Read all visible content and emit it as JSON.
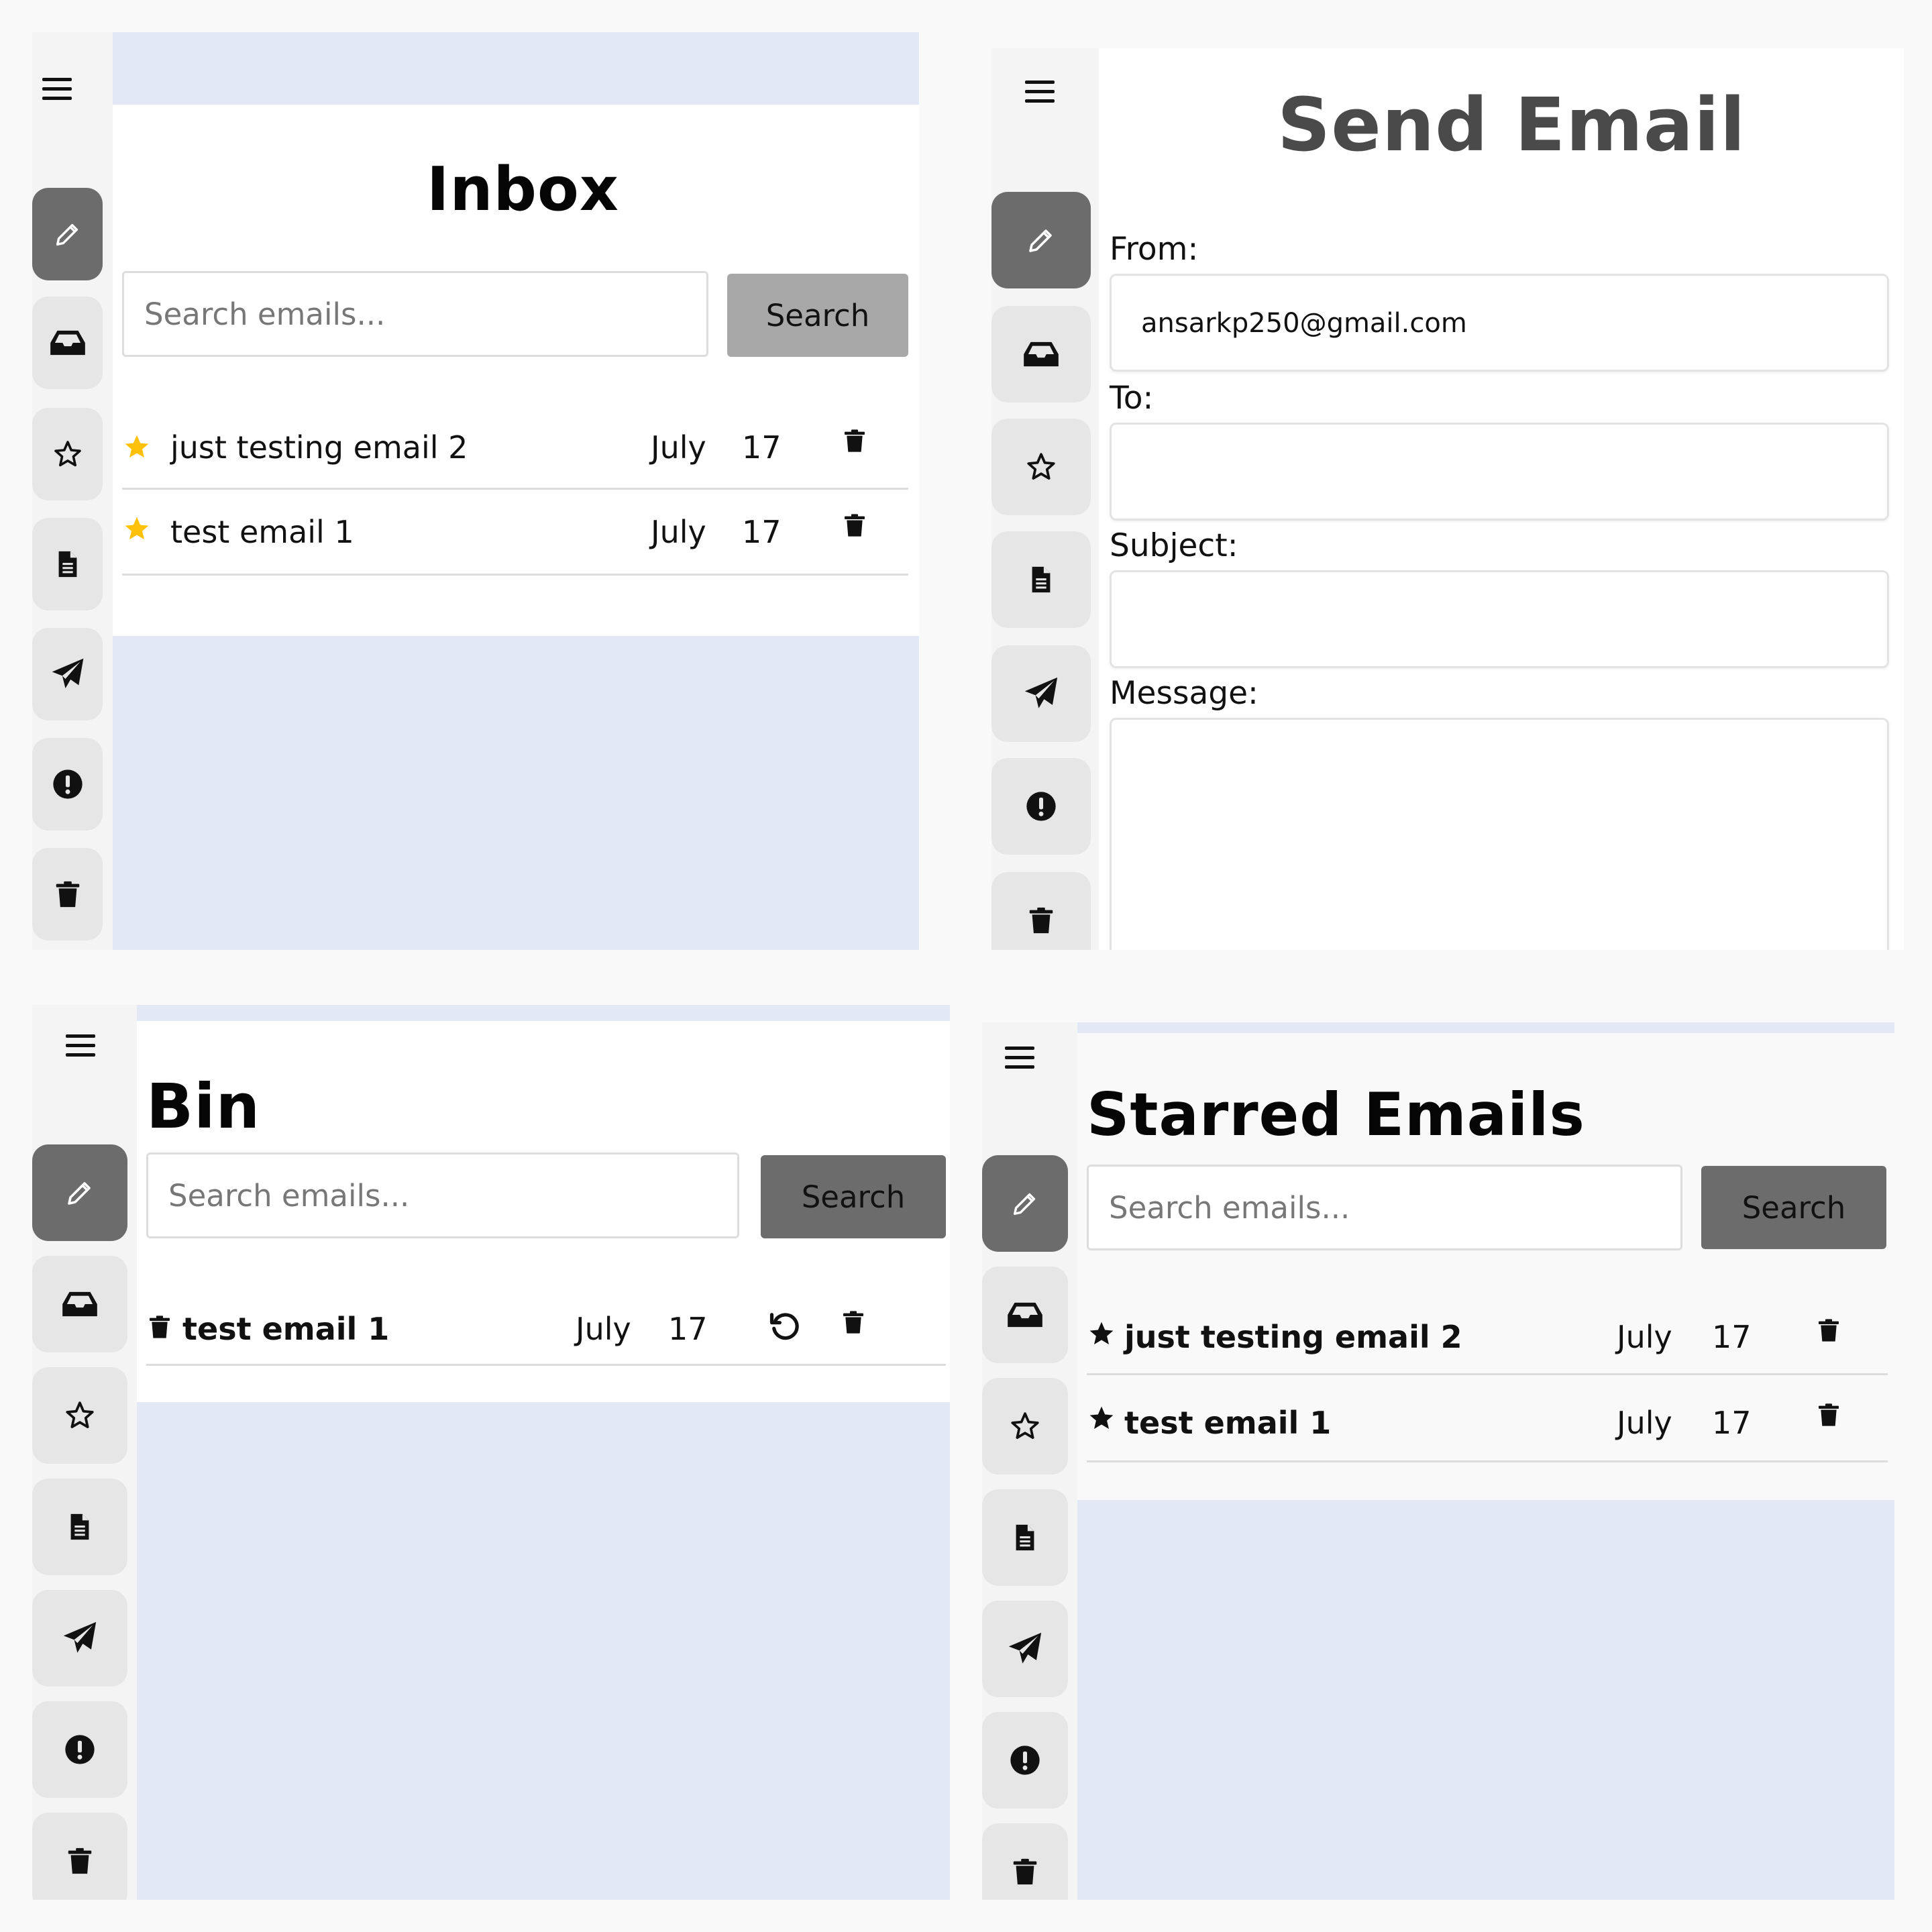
{
  "nav_icons": [
    "menu-icon",
    "pencil-icon",
    "inbox-icon",
    "star-icon",
    "document-icon",
    "send-icon",
    "alert-icon",
    "trash-icon"
  ],
  "colors": {
    "content_bg": "#e3e8f5",
    "sidebar_bg": "#f4f4f4",
    "nav_button": "#e6e6e6",
    "nav_button_active": "#6c6c6c",
    "star_yellow": "#ffc107",
    "search_button_light": "#a8a8a8",
    "search_button_dark": "#6c6c6c"
  },
  "inbox": {
    "title": "Inbox",
    "search": {
      "placeholder": "Search emails...",
      "button": "Search"
    },
    "emails": [
      {
        "subject": "just testing email 2",
        "month": "July",
        "day": "17"
      },
      {
        "subject": "test email 1",
        "month": "July",
        "day": "17"
      }
    ]
  },
  "compose": {
    "title": "Send Email",
    "from_label": "From:",
    "from_value": "ansarkp250@gmail.com",
    "to_label": "To:",
    "to_value": "",
    "subject_label": "Subject:",
    "subject_value": "",
    "message_label": "Message:",
    "message_value": ""
  },
  "bin": {
    "title": "Bin",
    "search": {
      "placeholder": "Search emails...",
      "button": "Search"
    },
    "emails": [
      {
        "subject": "test email 1",
        "month": "July",
        "day": "17"
      }
    ]
  },
  "starred": {
    "title": "Starred Emails",
    "search": {
      "placeholder": "Search emails...",
      "button": "Search"
    },
    "emails": [
      {
        "subject": "just testing email 2",
        "month": "July",
        "day": "17"
      },
      {
        "subject": "test email 1",
        "month": "July",
        "day": "17"
      }
    ]
  }
}
